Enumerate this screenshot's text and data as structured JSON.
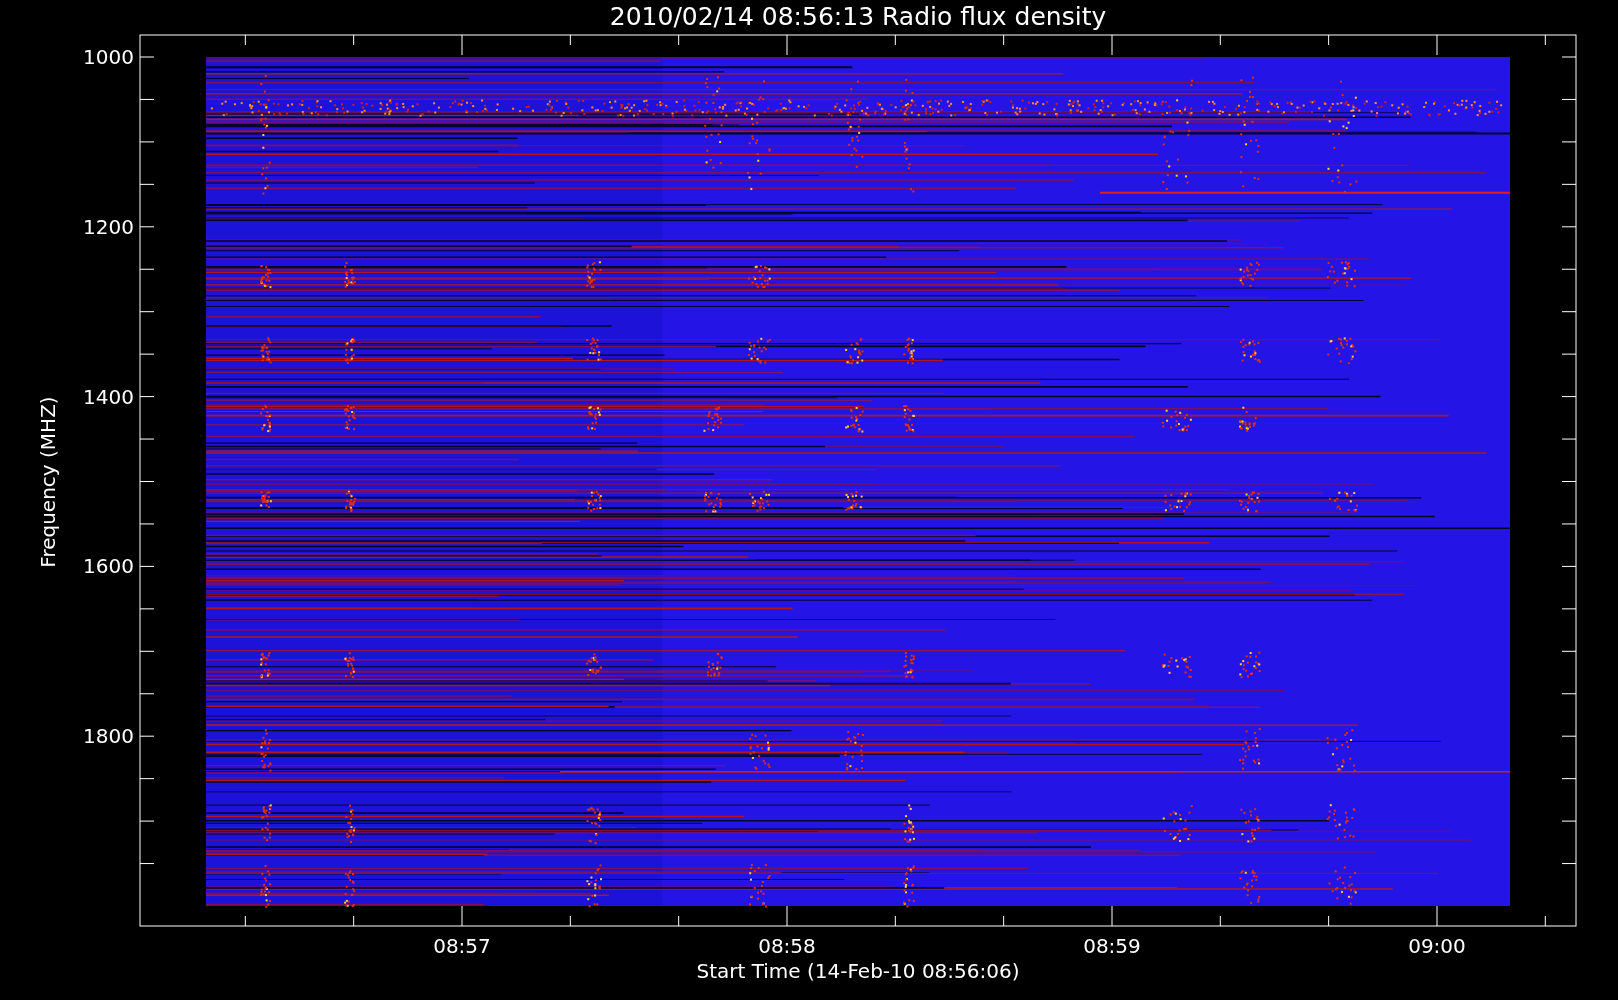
{
  "title": "2010/02/14 08:56:13 Radio flux density",
  "plot": {
    "ylabel": "Frequency (MHZ)",
    "xlabel": "Start Time (14-Feb-10 08:56:06)",
    "yticks": [
      "1000",
      "1200",
      "1400",
      "1600",
      "1800"
    ],
    "xticks": [
      "08:57",
      "08:58",
      "08:59",
      "09:00"
    ]
  }
}
